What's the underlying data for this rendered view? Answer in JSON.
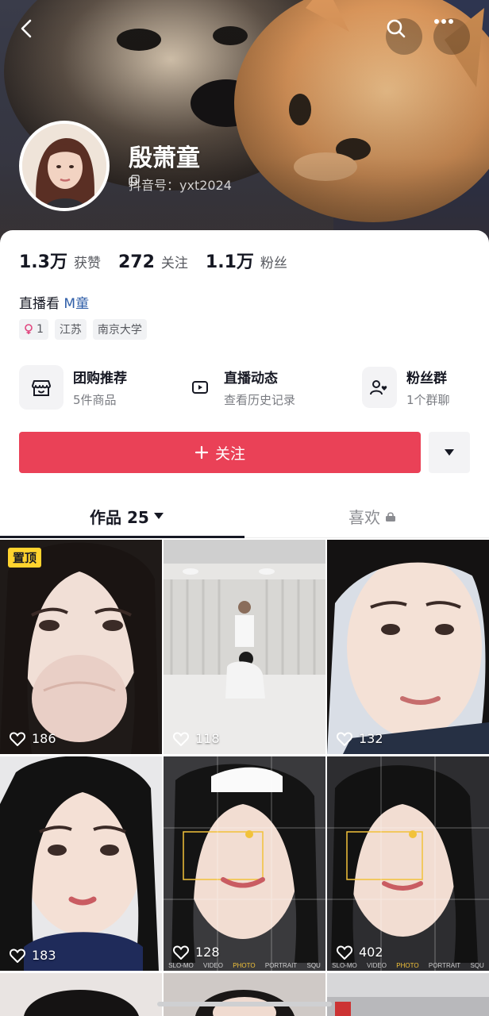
{
  "header": {
    "back_icon": "chevron-left-icon",
    "search_icon": "search-icon",
    "more_icon": "more-dots-icon"
  },
  "profile": {
    "name": "殷萧童",
    "douyin_id": "抖音号：yxt2024",
    "copy_icon": "copy-icon"
  },
  "stats": [
    {
      "value": "1.3万",
      "label": "获赞"
    },
    {
      "value": "272",
      "label": "关注"
    },
    {
      "value": "1.1万",
      "label": "粉丝"
    }
  ],
  "bio": {
    "prefix": "直播看",
    "link": "M童"
  },
  "tags": [
    {
      "text": "1",
      "icon": "female-icon"
    },
    {
      "text": "江苏"
    },
    {
      "text": "南京大学"
    }
  ],
  "features": [
    {
      "title": "团购推荐",
      "subtitle": "5件商品",
      "icon": "shop-bag-icon"
    },
    {
      "title": "直播动态",
      "subtitle": "查看历史记录",
      "icon": "live-icon"
    },
    {
      "title": "粉丝群",
      "subtitle": "1个群聊",
      "icon": "fan-group-icon"
    }
  ],
  "actions": {
    "follow_label": "关注",
    "plus_icon": "plus-icon",
    "dropdown_icon": "caret-down-icon"
  },
  "tabs": {
    "works_label": "作品 25",
    "likes_label": "喜欢"
  },
  "grid": {
    "pinned_label": "置顶",
    "items": [
      {
        "likes": "186"
      },
      {
        "likes": "118"
      },
      {
        "likes": "132"
      },
      {
        "likes": "183"
      },
      {
        "likes": "128"
      },
      {
        "likes": "402"
      }
    ],
    "camera_modes": [
      "SLO-MO",
      "VIDEO",
      "PHOTO",
      "PORTRAIT",
      "SQU"
    ]
  },
  "colors": {
    "accent": "#ea4157",
    "pin": "#ffd32e",
    "text": "#161823"
  }
}
